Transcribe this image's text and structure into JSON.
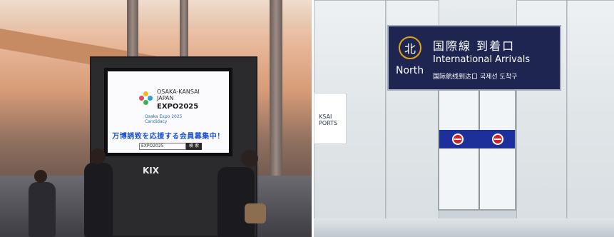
{
  "left_photo": {
    "expo_logo_text": "OSAKA-KANSAI\nJAPAN",
    "expo_main": "EXPO2025",
    "expo_sub": "Osaka Expo 2025\nCandidacy",
    "campaign_text": "万博誘致を応援する会員募集中！",
    "search_field": "EXPO2025",
    "search_button": "検 索",
    "kiosk_brand": "KIX"
  },
  "right_photo": {
    "sign_kanji": "北",
    "sign_north": "North",
    "sign_japanese": "国際線 到着口",
    "sign_english": "International Arrivals",
    "sign_chinese_korean": "国际航线到达口  국제선 도착구",
    "side_label": "KSAI\nPORTS"
  }
}
